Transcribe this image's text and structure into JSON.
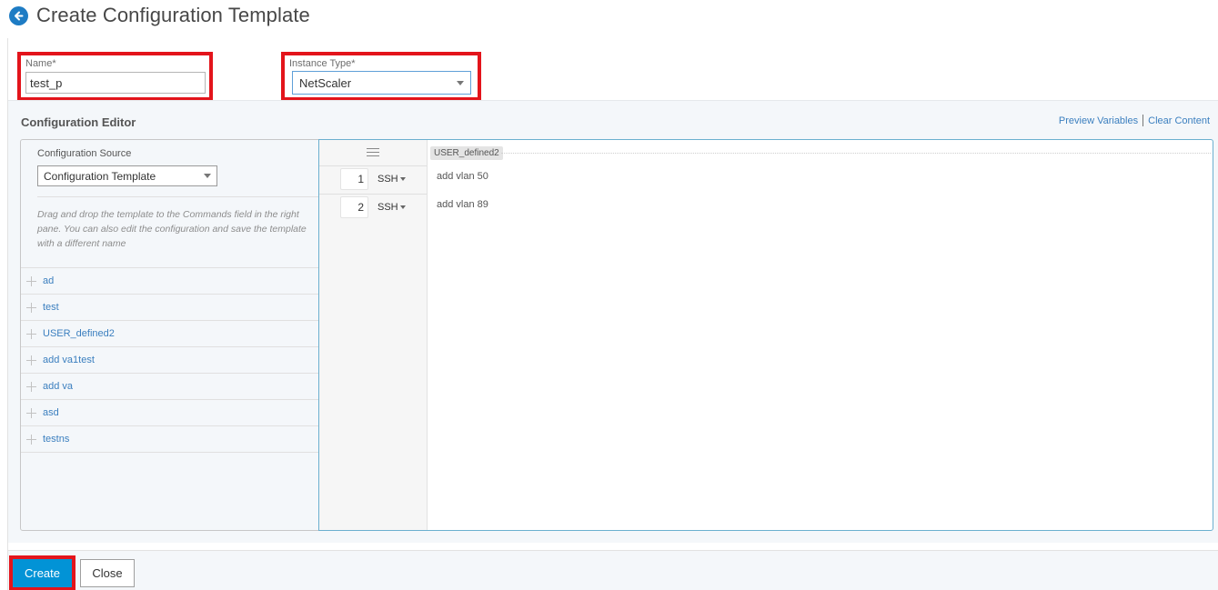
{
  "header": {
    "title": "Create Configuration Template",
    "back_icon": "arrow-left-circle-icon"
  },
  "form": {
    "name": {
      "label": "Name*",
      "value": "test_p"
    },
    "instance_type": {
      "label": "Instance Type*",
      "selected": "NetScaler"
    }
  },
  "editor": {
    "title": "Configuration Editor",
    "links": {
      "preview_variables": "Preview Variables",
      "clear_content": "Clear Content"
    },
    "source": {
      "label": "Configuration Source",
      "selected": "Configuration Template",
      "help_text": "Drag and drop the template to the Commands field in the right pane. You can also edit the configuration and save the template with a different name"
    },
    "templates": [
      {
        "name": "ad"
      },
      {
        "name": "test"
      },
      {
        "name": "USER_defined2"
      },
      {
        "name": "add va1test"
      },
      {
        "name": "add va"
      },
      {
        "name": "asd"
      },
      {
        "name": "testns"
      }
    ],
    "commands": {
      "header_chip": "USER_defined2",
      "lines": [
        {
          "number": "1",
          "protocol": "SSH",
          "command": "add vlan 50"
        },
        {
          "number": "2",
          "protocol": "SSH",
          "command": "add vlan 89"
        }
      ]
    }
  },
  "footer": {
    "create_label": "Create",
    "close_label": "Close"
  },
  "colors": {
    "accent": "#0293d6",
    "link": "#3b7fbf",
    "highlight_box": "#e3141b"
  }
}
